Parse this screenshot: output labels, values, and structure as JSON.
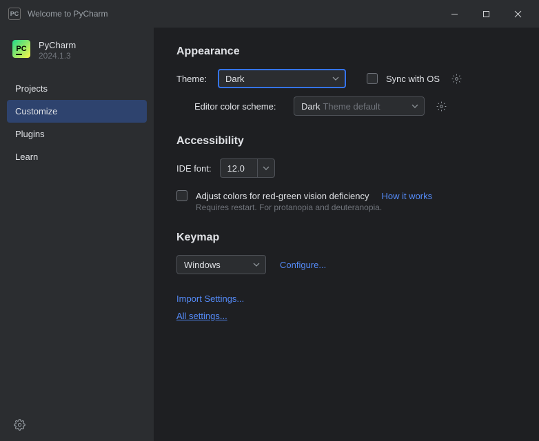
{
  "window": {
    "title": "Welcome to PyCharm"
  },
  "brand": {
    "name": "PyCharm",
    "version": "2024.1.3",
    "logo_text": "PC"
  },
  "sidebar": {
    "items": [
      {
        "label": "Projects"
      },
      {
        "label": "Customize"
      },
      {
        "label": "Plugins"
      },
      {
        "label": "Learn"
      }
    ],
    "active_index": 1
  },
  "appearance": {
    "heading": "Appearance",
    "theme_label": "Theme:",
    "theme_value": "Dark",
    "sync_label": "Sync with OS",
    "editor_scheme_label": "Editor color scheme:",
    "editor_scheme_value": "Dark",
    "editor_scheme_placeholder": "Theme default"
  },
  "accessibility": {
    "heading": "Accessibility",
    "font_label": "IDE font:",
    "font_value": "12.0",
    "adjust_label": "Adjust colors for red-green vision deficiency",
    "how_link": "How it works",
    "hint": "Requires restart. For protanopia and deuteranopia."
  },
  "keymap": {
    "heading": "Keymap",
    "value": "Windows",
    "configure": "Configure..."
  },
  "links": {
    "import": "Import Settings...",
    "all": "All settings..."
  }
}
